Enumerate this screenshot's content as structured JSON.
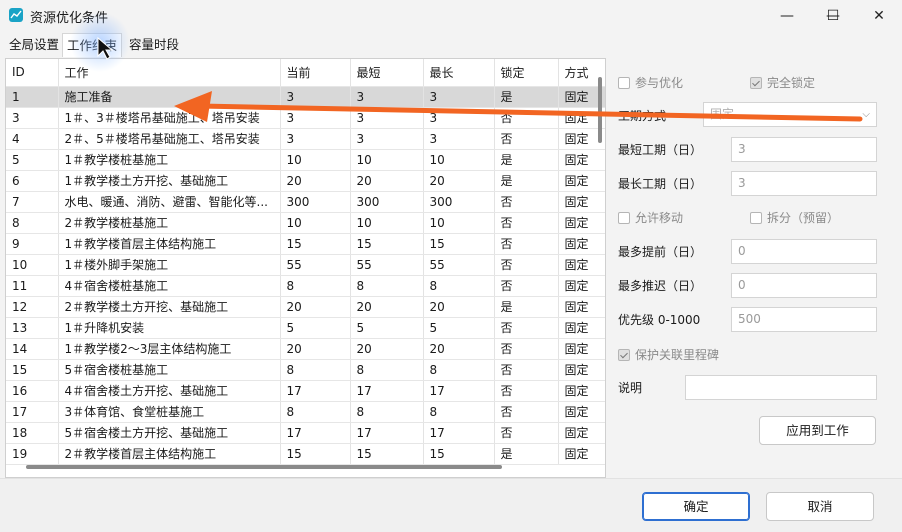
{
  "window": {
    "title": "资源优化条件",
    "minimize": "—",
    "maximize": "☐",
    "close": "✕"
  },
  "tabs": [
    {
      "label": "全局设置"
    },
    {
      "label": "工作约束"
    },
    {
      "label": "容量时段"
    }
  ],
  "table": {
    "headers": [
      "ID",
      "工作",
      "当前",
      "最短",
      "最长",
      "锁定",
      "方式"
    ],
    "rows": [
      [
        "1",
        "施工准备",
        "3",
        "3",
        "3",
        "是",
        "固定"
      ],
      [
        "3",
        "1＃、3＃楼塔吊基础施工、塔吊安装",
        "3",
        "3",
        "3",
        "否",
        "固定"
      ],
      [
        "4",
        "2＃、5＃楼塔吊基础施工、塔吊安装",
        "3",
        "3",
        "3",
        "否",
        "固定"
      ],
      [
        "5",
        "1＃教学楼桩基施工",
        "10",
        "10",
        "10",
        "是",
        "固定"
      ],
      [
        "6",
        "1＃教学楼土方开挖、基础施工",
        "20",
        "20",
        "20",
        "是",
        "固定"
      ],
      [
        "7",
        "水电、暖通、消防、避雷、智能化等...",
        "300",
        "300",
        "300",
        "否",
        "固定"
      ],
      [
        "8",
        "2＃教学楼桩基施工",
        "10",
        "10",
        "10",
        "否",
        "固定"
      ],
      [
        "9",
        "1＃教学楼首层主体结构施工",
        "15",
        "15",
        "15",
        "否",
        "固定"
      ],
      [
        "10",
        "1＃楼外脚手架施工",
        "55",
        "55",
        "55",
        "否",
        "固定"
      ],
      [
        "11",
        "4＃宿舍楼桩基施工",
        "8",
        "8",
        "8",
        "否",
        "固定"
      ],
      [
        "12",
        "2＃教学楼土方开挖、基础施工",
        "20",
        "20",
        "20",
        "是",
        "固定"
      ],
      [
        "13",
        "1＃升降机安装",
        "5",
        "5",
        "5",
        "否",
        "固定"
      ],
      [
        "14",
        "1＃教学楼2～3层主体结构施工",
        "20",
        "20",
        "20",
        "否",
        "固定"
      ],
      [
        "15",
        "5＃宿舍楼桩基施工",
        "8",
        "8",
        "8",
        "否",
        "固定"
      ],
      [
        "16",
        "4＃宿舍楼土方开挖、基础施工",
        "17",
        "17",
        "17",
        "否",
        "固定"
      ],
      [
        "17",
        "3＃体育馆、食堂桩基施工",
        "8",
        "8",
        "8",
        "否",
        "固定"
      ],
      [
        "18",
        "5＃宿舍楼土方开挖、基础施工",
        "17",
        "17",
        "17",
        "否",
        "固定"
      ],
      [
        "19",
        "2＃教学楼首层主体结构施工",
        "15",
        "15",
        "15",
        "是",
        "固定"
      ]
    ]
  },
  "right_panel": {
    "participate_label": "参与优化",
    "full_lock_label": "完全锁定",
    "mode_label": "工期方式",
    "mode_value": "固定",
    "min_duration_label": "最短工期（日）",
    "min_duration_value": "3",
    "max_duration_label": "最长工期（日）",
    "max_duration_value": "3",
    "allow_move_label": "允许移动",
    "split_label": "拆分（预留）",
    "max_advance_label": "最多提前（日）",
    "max_advance_value": "0",
    "max_delay_label": "最多推迟（日）",
    "max_delay_value": "0",
    "priority_label": "优先级 0-1000",
    "priority_value": "500",
    "protect_label": "保护关联里程碑",
    "note_label": "说明",
    "note_value": "",
    "apply_button": "应用到工作"
  },
  "footer": {
    "ok_button": "确定",
    "cancel_button": "取消"
  },
  "colors": {
    "arrow": "#f26522",
    "accent": "#2e6fd1",
    "selected_row": "#d8d8d8"
  }
}
